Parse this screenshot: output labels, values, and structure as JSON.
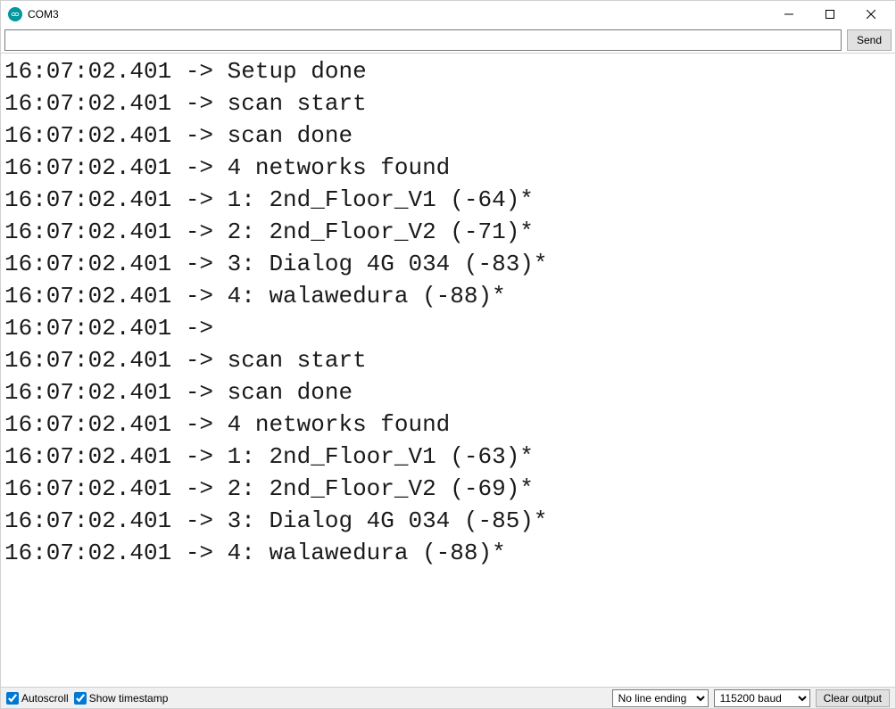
{
  "window": {
    "title": "COM3"
  },
  "toolbar": {
    "input_value": "",
    "send_label": "Send"
  },
  "console": {
    "lines": [
      "16:07:02.401 -> Setup done",
      "16:07:02.401 -> scan start",
      "16:07:02.401 -> scan done",
      "16:07:02.401 -> 4 networks found",
      "16:07:02.401 -> 1: 2nd_Floor_V1 (-64)*",
      "16:07:02.401 -> 2: 2nd_Floor_V2 (-71)*",
      "16:07:02.401 -> 3: Dialog 4G 034 (-83)*",
      "16:07:02.401 -> 4: walawedura (-88)*",
      "16:07:02.401 -> ",
      "16:07:02.401 -> scan start",
      "16:07:02.401 -> scan done",
      "16:07:02.401 -> 4 networks found",
      "16:07:02.401 -> 1: 2nd_Floor_V1 (-63)*",
      "16:07:02.401 -> 2: 2nd_Floor_V2 (-69)*",
      "16:07:02.401 -> 3: Dialog 4G 034 (-85)*",
      "16:07:02.401 -> 4: walawedura (-88)*"
    ]
  },
  "footer": {
    "autoscroll_label": "Autoscroll",
    "autoscroll_checked": true,
    "timestamp_label": "Show timestamp",
    "timestamp_checked": true,
    "line_ending_selected": "No line ending",
    "baud_selected": "115200 baud",
    "clear_label": "Clear output"
  }
}
